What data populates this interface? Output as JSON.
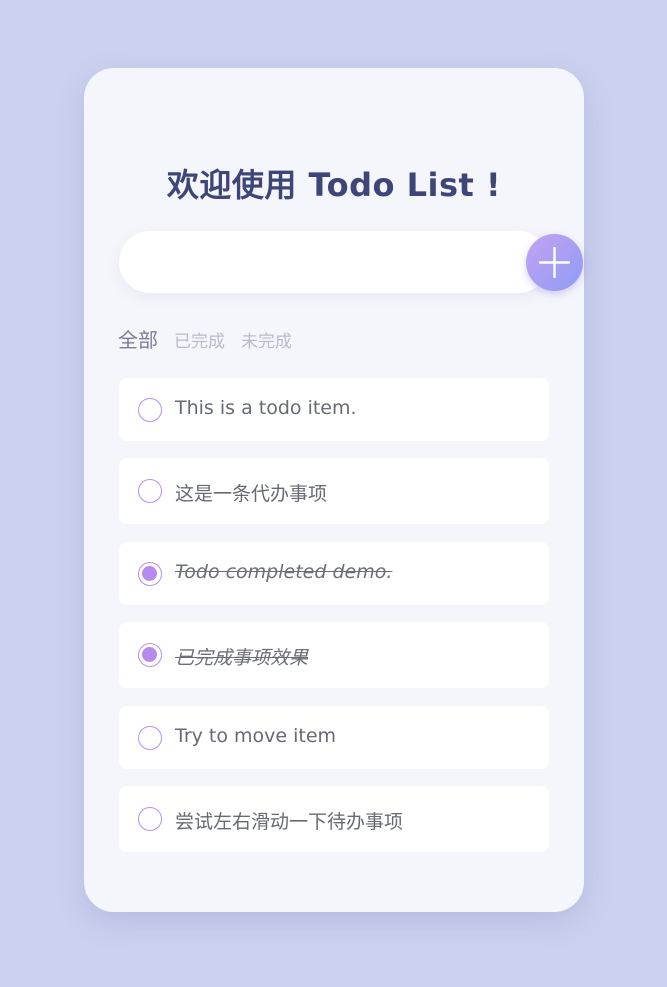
{
  "header": {
    "title": "欢迎使用 Todo List !"
  },
  "new_todo": {
    "value": "",
    "placeholder": "",
    "add_icon": "plus-icon"
  },
  "filters": [
    {
      "label": "全部",
      "active": true
    },
    {
      "label": "已完成",
      "active": false
    },
    {
      "label": "未完成",
      "active": false
    }
  ],
  "todos": [
    {
      "text": "This is a todo item.",
      "done": false
    },
    {
      "text": "这是一条代办事项",
      "done": false
    },
    {
      "text": "Todo completed demo.",
      "done": true
    },
    {
      "text": "已完成事项效果",
      "done": true
    },
    {
      "text": "Try to move item",
      "done": false
    },
    {
      "text": "尝试左右滑动一下待办事项",
      "done": false
    }
  ],
  "colors": {
    "background": "#cbd1ef",
    "card": "#f5f6fb",
    "title": "#3e4677",
    "accent_start": "#c4a2f2",
    "accent_end": "#8e9cf4",
    "check": "#b78af0"
  }
}
